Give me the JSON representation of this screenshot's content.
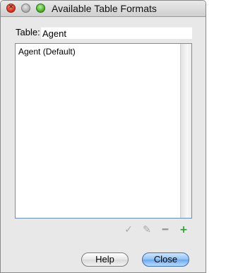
{
  "window": {
    "title": "Available Table Formats"
  },
  "form": {
    "table_label": "Table:",
    "table_value": "Agent"
  },
  "formats": {
    "items": [
      "Agent (Default)"
    ]
  },
  "toolbar": {
    "icons": [
      "check-icon",
      "edit-pencil-icon",
      "remove-minus-icon",
      "add-plus-icon"
    ]
  },
  "buttons": {
    "help": "Help",
    "close": "Close"
  },
  "colors": {
    "window_bg": "#e8e8e8",
    "list_border": "#6b8fbf",
    "add_green": "#2f9a2f",
    "default_button": "#8ec1f5"
  }
}
